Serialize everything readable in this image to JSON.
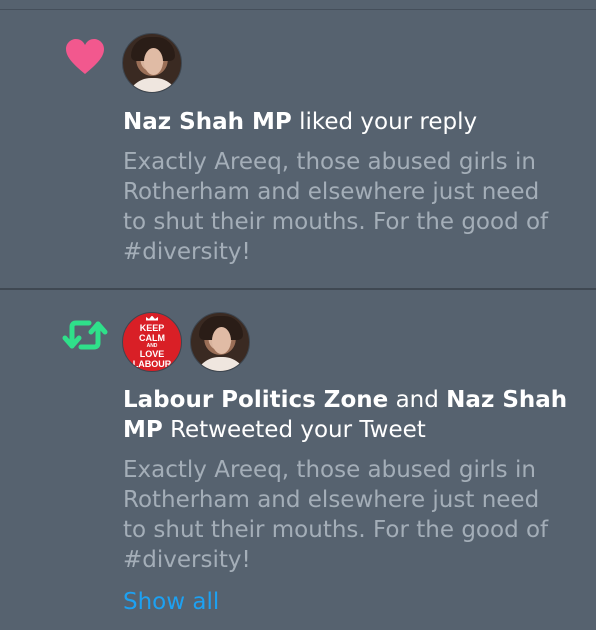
{
  "notifications": [
    {
      "type": "like",
      "icon": "heart-icon",
      "icon_color": "#e0245e",
      "actor": "Naz Shah MP",
      "action": "liked your reply",
      "tweet_lines": [
        "Exactly Areeq, those abused girls in",
        "Rotherham and elsewhere just need",
        "to shut their mouths. For the good of",
        "#diversity!"
      ]
    },
    {
      "type": "retweet",
      "icon": "retweet-icon",
      "icon_color": "#19cf86",
      "actor1": "Labour Politics Zone",
      "connector": "and",
      "actor2_line1": "Naz Shah",
      "actor2_line2": "MP",
      "action": "Retweeted your Tweet",
      "avatar_keep_calm": {
        "line1": "KEEP",
        "line2": "CALM",
        "line3": "AND",
        "line4": "LOVE",
        "line5": "LABOUR"
      },
      "tweet_lines": [
        "Exactly Areeq, those abused girls in",
        "Rotherham and elsewhere just need",
        "to shut their mouths. For the good of",
        "#diversity!"
      ],
      "show_all": "Show all"
    }
  ],
  "colors": {
    "background": "#56626f",
    "tweet_text": "#a4aeb8",
    "link": "#1da1f2"
  }
}
